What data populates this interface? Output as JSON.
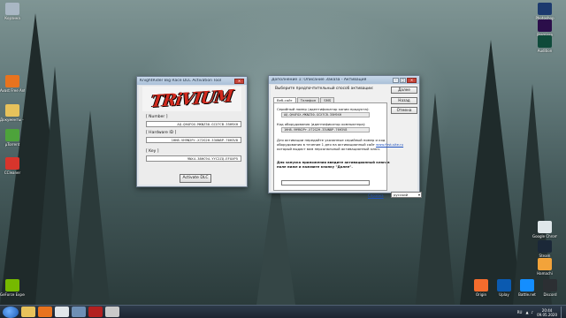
{
  "desktop_left_icons": [
    {
      "label": "Корзина",
      "icon": "recycle-bin-icon",
      "color": "#a9b7c4"
    },
    {
      "label": "Avast Free Antivirus",
      "icon": "avast-icon",
      "color": "#e8731e"
    },
    {
      "label": "Документы - Ярлык",
      "icon": "folder-icon",
      "color": "#e7c25b"
    },
    {
      "label": "µTorrent",
      "icon": "utorrent-icon",
      "color": "#4da33b"
    },
    {
      "label": "CCleaner",
      "icon": "ccleaner-icon",
      "color": "#d8352c"
    },
    {
      "label": "GeForce Experience",
      "icon": "geforce-icon",
      "color": "#76b900"
    }
  ],
  "desktop_right_icons": [
    {
      "label": "Photoshop",
      "icon": "photoshop-icon",
      "color": "#1c3a6e"
    },
    {
      "label": "Premiere",
      "icon": "premiere-icon",
      "color": "#2b0e4a"
    },
    {
      "label": "Audition",
      "icon": "audition-icon",
      "color": "#0f4a3a"
    },
    {
      "label": "Google Chrome",
      "icon": "chrome-icon",
      "color": "#dfe7ea"
    },
    {
      "label": "Steam",
      "icon": "steam-icon",
      "color": "#1b2838"
    },
    {
      "label": "Hamachi",
      "icon": "hamachi-icon",
      "color": "#f2a33a"
    },
    {
      "label": "Origin",
      "icon": "origin-icon",
      "color": "#f56c2d"
    },
    {
      "label": "Uplay",
      "icon": "uplay-icon",
      "color": "#0b5ab0"
    },
    {
      "label": "Battle.net",
      "icon": "battlenet-icon",
      "color": "#148eff"
    },
    {
      "label": "Discord",
      "icon": "discord-icon",
      "color": "#2c2f33"
    }
  ],
  "dlc_tool": {
    "title": "KnightRider Big Race DLC Activation Tool",
    "logo_text": "TRiVIUM",
    "number_label": "[ Number ]",
    "number_value": "AQ-QH4FOX-MKNZ30-GCX7CB-35H9XH",
    "hwid_label": "[ Hardware ID ]",
    "hwid_value": "1HH8-VH9N2Pr-X72G2H-33UN8P-76H3V8",
    "key_label": "[ Key ]",
    "key_value": "9NX4-38HC94-YYC2ZQ-EFUXP5",
    "activate_label": "Activate DLC"
  },
  "wizard": {
    "title": "Дополнение 1: Описание Заказа - Активация",
    "instruction": "Выберите предпочтительный способ активации:",
    "buttons": {
      "next": "Далее",
      "back": "Назад",
      "cancel": "Отмена"
    },
    "tabs": [
      "Веб-сайт",
      "Телефон",
      "SMS"
    ],
    "active_tab": 0,
    "serial_label": "Серийный номер (идентификатор копии продукта):",
    "serial_value": "AQ-QH4FOX-MKNZ30-GCX7CB-35H9XH",
    "hw_label": "Код оборудования (идентификатор компьютера):",
    "hw_value": "1HH8-VH9N2Pr-X72G2H-33UN8P-76H3V8",
    "info_line1": "Для активации передайте указанные серийный номер и код",
    "info_line2": "оборудования в течение 1 дня на активационный сайт",
    "info_link": "www.first-site.ru",
    "info_line3": "который выдаст вам персональный активационный ключ.",
    "key_prompt_line1": "Для запуска приложения введите активационный ключ в",
    "key_prompt_line2": "поле ниже и нажмите кнопку \"Далее\".",
    "help_link": "Справка",
    "language": "русский"
  },
  "tray": {
    "lang": "RU",
    "time": "20:44",
    "date": "09.05.2020"
  },
  "taskbar_apps": [
    {
      "icon": "explorer-icon",
      "color": "#e7c25b"
    },
    {
      "icon": "media-player-icon",
      "color": "#e8731e"
    },
    {
      "icon": "chrome-icon",
      "color": "#e1e6ea"
    },
    {
      "icon": "window-app-icon",
      "color": "#6e8fb5"
    },
    {
      "icon": "trivium-app-icon",
      "color": "#b32020"
    },
    {
      "icon": "activation-app-icon",
      "color": "#c9c9c9"
    }
  ]
}
